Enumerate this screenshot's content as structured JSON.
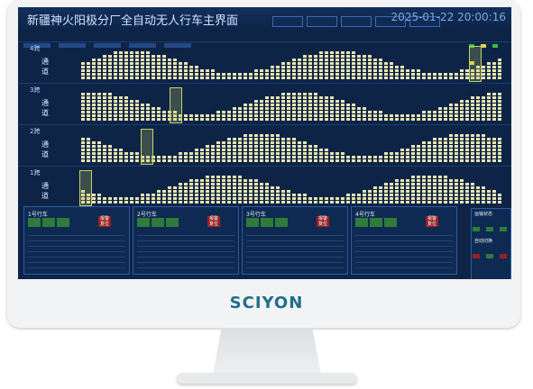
{
  "screen": {
    "title": "新疆神火阳极分厂全自动无人行车主界面",
    "datetime": "2025-01-22  20:00:16",
    "menu": [
      "",
      "",
      "",
      "",
      ""
    ],
    "bays": [
      {
        "label": "4跨",
        "side": "通道"
      },
      {
        "label": "3跨",
        "side": "通道"
      },
      {
        "label": "2跨",
        "side": "通道"
      },
      {
        "label": "1跨",
        "side": "通道"
      }
    ],
    "panels": [
      {
        "title": "1号行车",
        "btn1": "报警",
        "btn2": "复位"
      },
      {
        "title": "2号行车",
        "btn1": "报警",
        "btn2": "复位"
      },
      {
        "title": "3号行车",
        "btn1": "报警",
        "btn2": "复位"
      },
      {
        "title": "4号行车",
        "btn1": "报警",
        "btn2": "复位"
      }
    ],
    "right_panel": {
      "label1": "运输状态",
      "label2": "自动切换"
    }
  },
  "brand": "SCIYON"
}
